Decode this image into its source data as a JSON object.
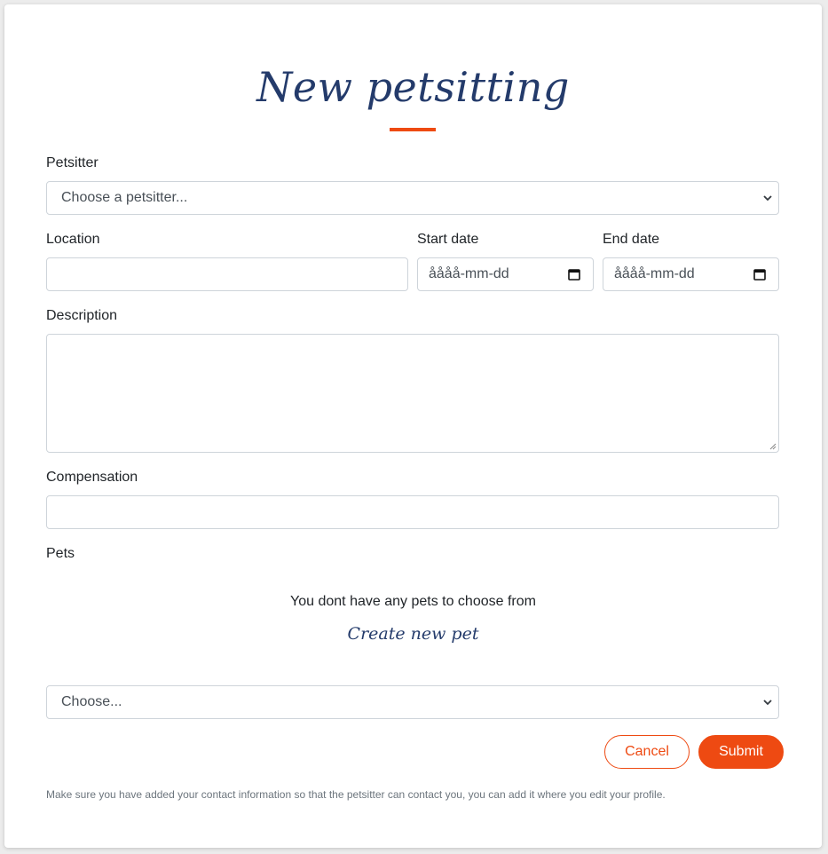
{
  "header": {
    "title": "New petsitting"
  },
  "form": {
    "petsitter": {
      "label": "Petsitter",
      "selected": "Choose a petsitter..."
    },
    "location": {
      "label": "Location",
      "value": ""
    },
    "start_date": {
      "label": "Start date",
      "placeholder": "åååå-mm-dd"
    },
    "end_date": {
      "label": "End date",
      "placeholder": "åååå-mm-dd"
    },
    "description": {
      "label": "Description",
      "value": ""
    },
    "compensation": {
      "label": "Compensation",
      "value": ""
    },
    "pets": {
      "label": "Pets",
      "empty_message": "You dont have any pets to choose from",
      "create_link": "Create new pet",
      "selected": "Choose..."
    }
  },
  "actions": {
    "cancel_label": "Cancel",
    "submit_label": "Submit"
  },
  "footnote": "Make sure you have added your contact information so that the petsitter can contact you, you can add it where you edit your profile.",
  "colors": {
    "accent": "#ee4a12",
    "title": "#243b6b",
    "border": "#ced4da"
  },
  "icons": {
    "select": "chevron-down-icon",
    "date": "calendar-icon"
  }
}
